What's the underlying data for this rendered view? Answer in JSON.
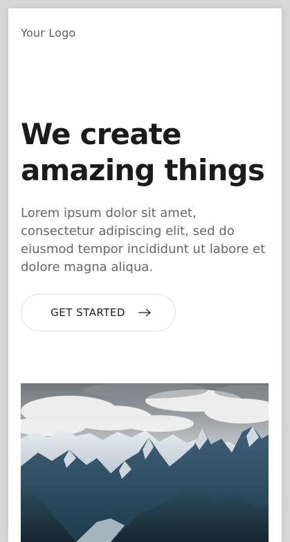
{
  "header": {
    "logo_text": "Your Logo"
  },
  "hero": {
    "headline_line1": "We create",
    "headline_line2": "amazing things",
    "body_text": "Lorem ipsum dolor sit amet, consectetur adipiscing elit, sed do eiusmod tempor incididunt ut labore et dolore magna aliqua.",
    "cta_label": "GET STARTED",
    "cta_icon": "arrow-right-icon",
    "image_subject": "mountain-landscape"
  }
}
